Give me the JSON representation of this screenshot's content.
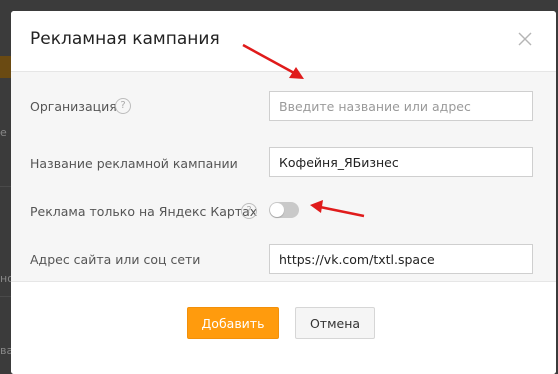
{
  "background": {
    "partial_texts": [
      "е",
      "но",
      "ва"
    ]
  },
  "dialog": {
    "title": "Рекламная кампания",
    "close_icon": "close-x-icon",
    "fields": {
      "organization": {
        "label": "Организация",
        "placeholder": "Введите название или адрес",
        "value": ""
      },
      "campaign_name": {
        "label": "Название рекламной кампании",
        "value": "Кофейня_ЯБизнес"
      },
      "yandex_maps_only": {
        "label": "Реклама только на Яндекс Картах",
        "toggle_on": false
      },
      "website": {
        "label": "Адрес сайта или соц сети",
        "value": "https://vk.com/txtl.space"
      }
    },
    "help_glyph": "?",
    "buttons": {
      "add": "Добавить",
      "cancel": "Отмена"
    }
  },
  "colors": {
    "primary_button": "#ff9b0d",
    "annotation_arrow": "#e01b1b",
    "overlay": "#3a3a3a"
  }
}
